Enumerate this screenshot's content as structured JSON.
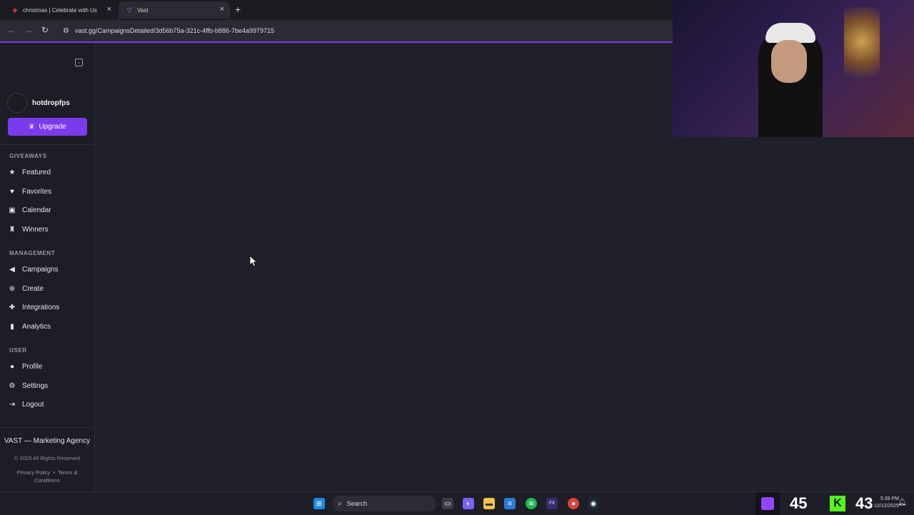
{
  "browser": {
    "tabs": [
      {
        "title": "christmas | Celebrate with Us",
        "active": false
      },
      {
        "title": "Vast",
        "active": true
      }
    ],
    "new_tab": "+",
    "url": "vast.gg/CampaignsDetailed/3d56b75a-321c-4ffb-b886-7be4a9979715",
    "accent_color": "#7c3aed"
  },
  "sidebar": {
    "username": "hotdropfps",
    "upgrade_label": "Upgrade",
    "sections": [
      {
        "label": "GIVEAWAYS",
        "items": [
          {
            "label": "Featured",
            "icon": "star-icon"
          },
          {
            "label": "Favorites",
            "icon": "heart-icon"
          },
          {
            "label": "Calendar",
            "icon": "calendar-icon"
          },
          {
            "label": "Winners",
            "icon": "trophy-icon"
          }
        ]
      },
      {
        "label": "MANAGEMENT",
        "items": [
          {
            "label": "Campaigns",
            "icon": "megaphone-icon"
          },
          {
            "label": "Create",
            "icon": "plus-circle-icon"
          },
          {
            "label": "Integrations",
            "icon": "puzzle-icon"
          },
          {
            "label": "Analytics",
            "icon": "bar-chart-icon"
          }
        ]
      },
      {
        "label": "USER",
        "items": [
          {
            "label": "Profile",
            "icon": "user-icon"
          },
          {
            "label": "Settings",
            "icon": "gear-icon"
          },
          {
            "label": "Logout",
            "icon": "logout-icon"
          }
        ]
      }
    ],
    "footer": {
      "title": "VAST — Marketing Agency",
      "copyright": "© 2025 All Rights Reserved",
      "privacy": "Privacy Policy",
      "separator": "•",
      "terms": "Terms & Conditions"
    }
  },
  "taskbar": {
    "search_label": "Search",
    "counter_twitch": "45",
    "counter_kick": "43",
    "clock_time": "5:39 PM",
    "clock_date": "12/12/2025"
  }
}
